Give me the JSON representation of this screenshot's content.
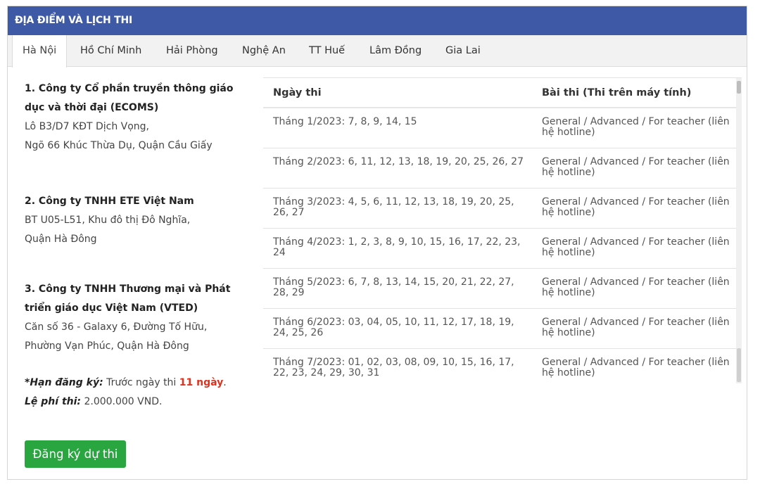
{
  "header": {
    "title": "ĐỊA ĐIỂM VÀ LỊCH THI"
  },
  "tabs": [
    {
      "label": "Hà Nội"
    },
    {
      "label": "Hồ Chí Minh"
    },
    {
      "label": "Hải Phòng"
    },
    {
      "label": "Nghệ An"
    },
    {
      "label": "TT Huế"
    },
    {
      "label": "Lâm Đồng"
    },
    {
      "label": "Gia Lai"
    }
  ],
  "locations": [
    {
      "name_line1": "1. Công ty Cổ phần truyền thông giáo",
      "name_line2": "dục và thời đại (ECOMS)",
      "addr_line1": "Lô B3/D7 KĐT Dịch Vọng,",
      "addr_line2": "Ngõ 66 Khúc Thừa Dụ, Quận Cầu Giấy"
    },
    {
      "name_line1": "2. Công ty TNHH ETE Việt Nam",
      "addr_line1": "BT U05-L51, Khu đô thị Đô Nghĩa,",
      "addr_line2": "Quận Hà Đông"
    },
    {
      "name_line1": "3. Công ty TNHH Thương mại và Phát",
      "name_line2": "triển giáo dục Việt Nam (VTED)",
      "addr_line1": "Căn số 36 - Galaxy 6, Đường Tố Hữu,",
      "addr_line2": "Phường Vạn Phúc, Quận Hà Đông"
    }
  ],
  "deadline": {
    "label": "*Hạn đăng ký:",
    "text": " Trước ngày thi ",
    "highlight": "11 ngày",
    "end": "."
  },
  "fee": {
    "label": "Lệ phí thi:",
    "value": " 2.000.000 VND."
  },
  "register_button": {
    "label": "Đăng ký dự thi"
  },
  "table": {
    "headers": [
      "Ngày thi",
      "Bài thi (Thi trên máy tính)"
    ],
    "rows": [
      {
        "date": "Tháng 1/2023: 7, 8, 9, 14, 15",
        "exam": "General / Advanced / For teacher (liên hệ hotline)"
      },
      {
        "date": "Tháng 2/2023: 6, 11, 12, 13, 18, 19, 20, 25, 26, 27",
        "exam": "General / Advanced / For teacher (liên hệ hotline)"
      },
      {
        "date": "Tháng 3/2023: 4, 5, 6, 11, 12, 13, 18, 19, 20, 25, 26, 27",
        "exam": "General / Advanced / For teacher (liên hệ hotline)"
      },
      {
        "date": "Tháng 4/2023: 1, 2, 3, 8, 9, 10, 15, 16, 17, 22, 23, 24",
        "exam": "General / Advanced / For teacher (liên hệ hotline)"
      },
      {
        "date": "Tháng 5/2023: 6, 7, 8, 13, 14, 15, 20, 21, 22, 27, 28, 29",
        "exam": "General / Advanced / For teacher (liên hệ hotline)"
      },
      {
        "date": "Tháng 6/2023: 03, 04, 05, 10, 11, 12, 17, 18, 19, 24, 25, 26",
        "exam": "General / Advanced / For teacher (liên hệ hotline)"
      },
      {
        "date": "Tháng 7/2023: 01, 02, 03, 08, 09, 10, 15, 16, 17, 22, 23, 24, 29, 30, 31",
        "exam": "General / Advanced / For teacher (liên hệ hotline)"
      }
    ]
  }
}
